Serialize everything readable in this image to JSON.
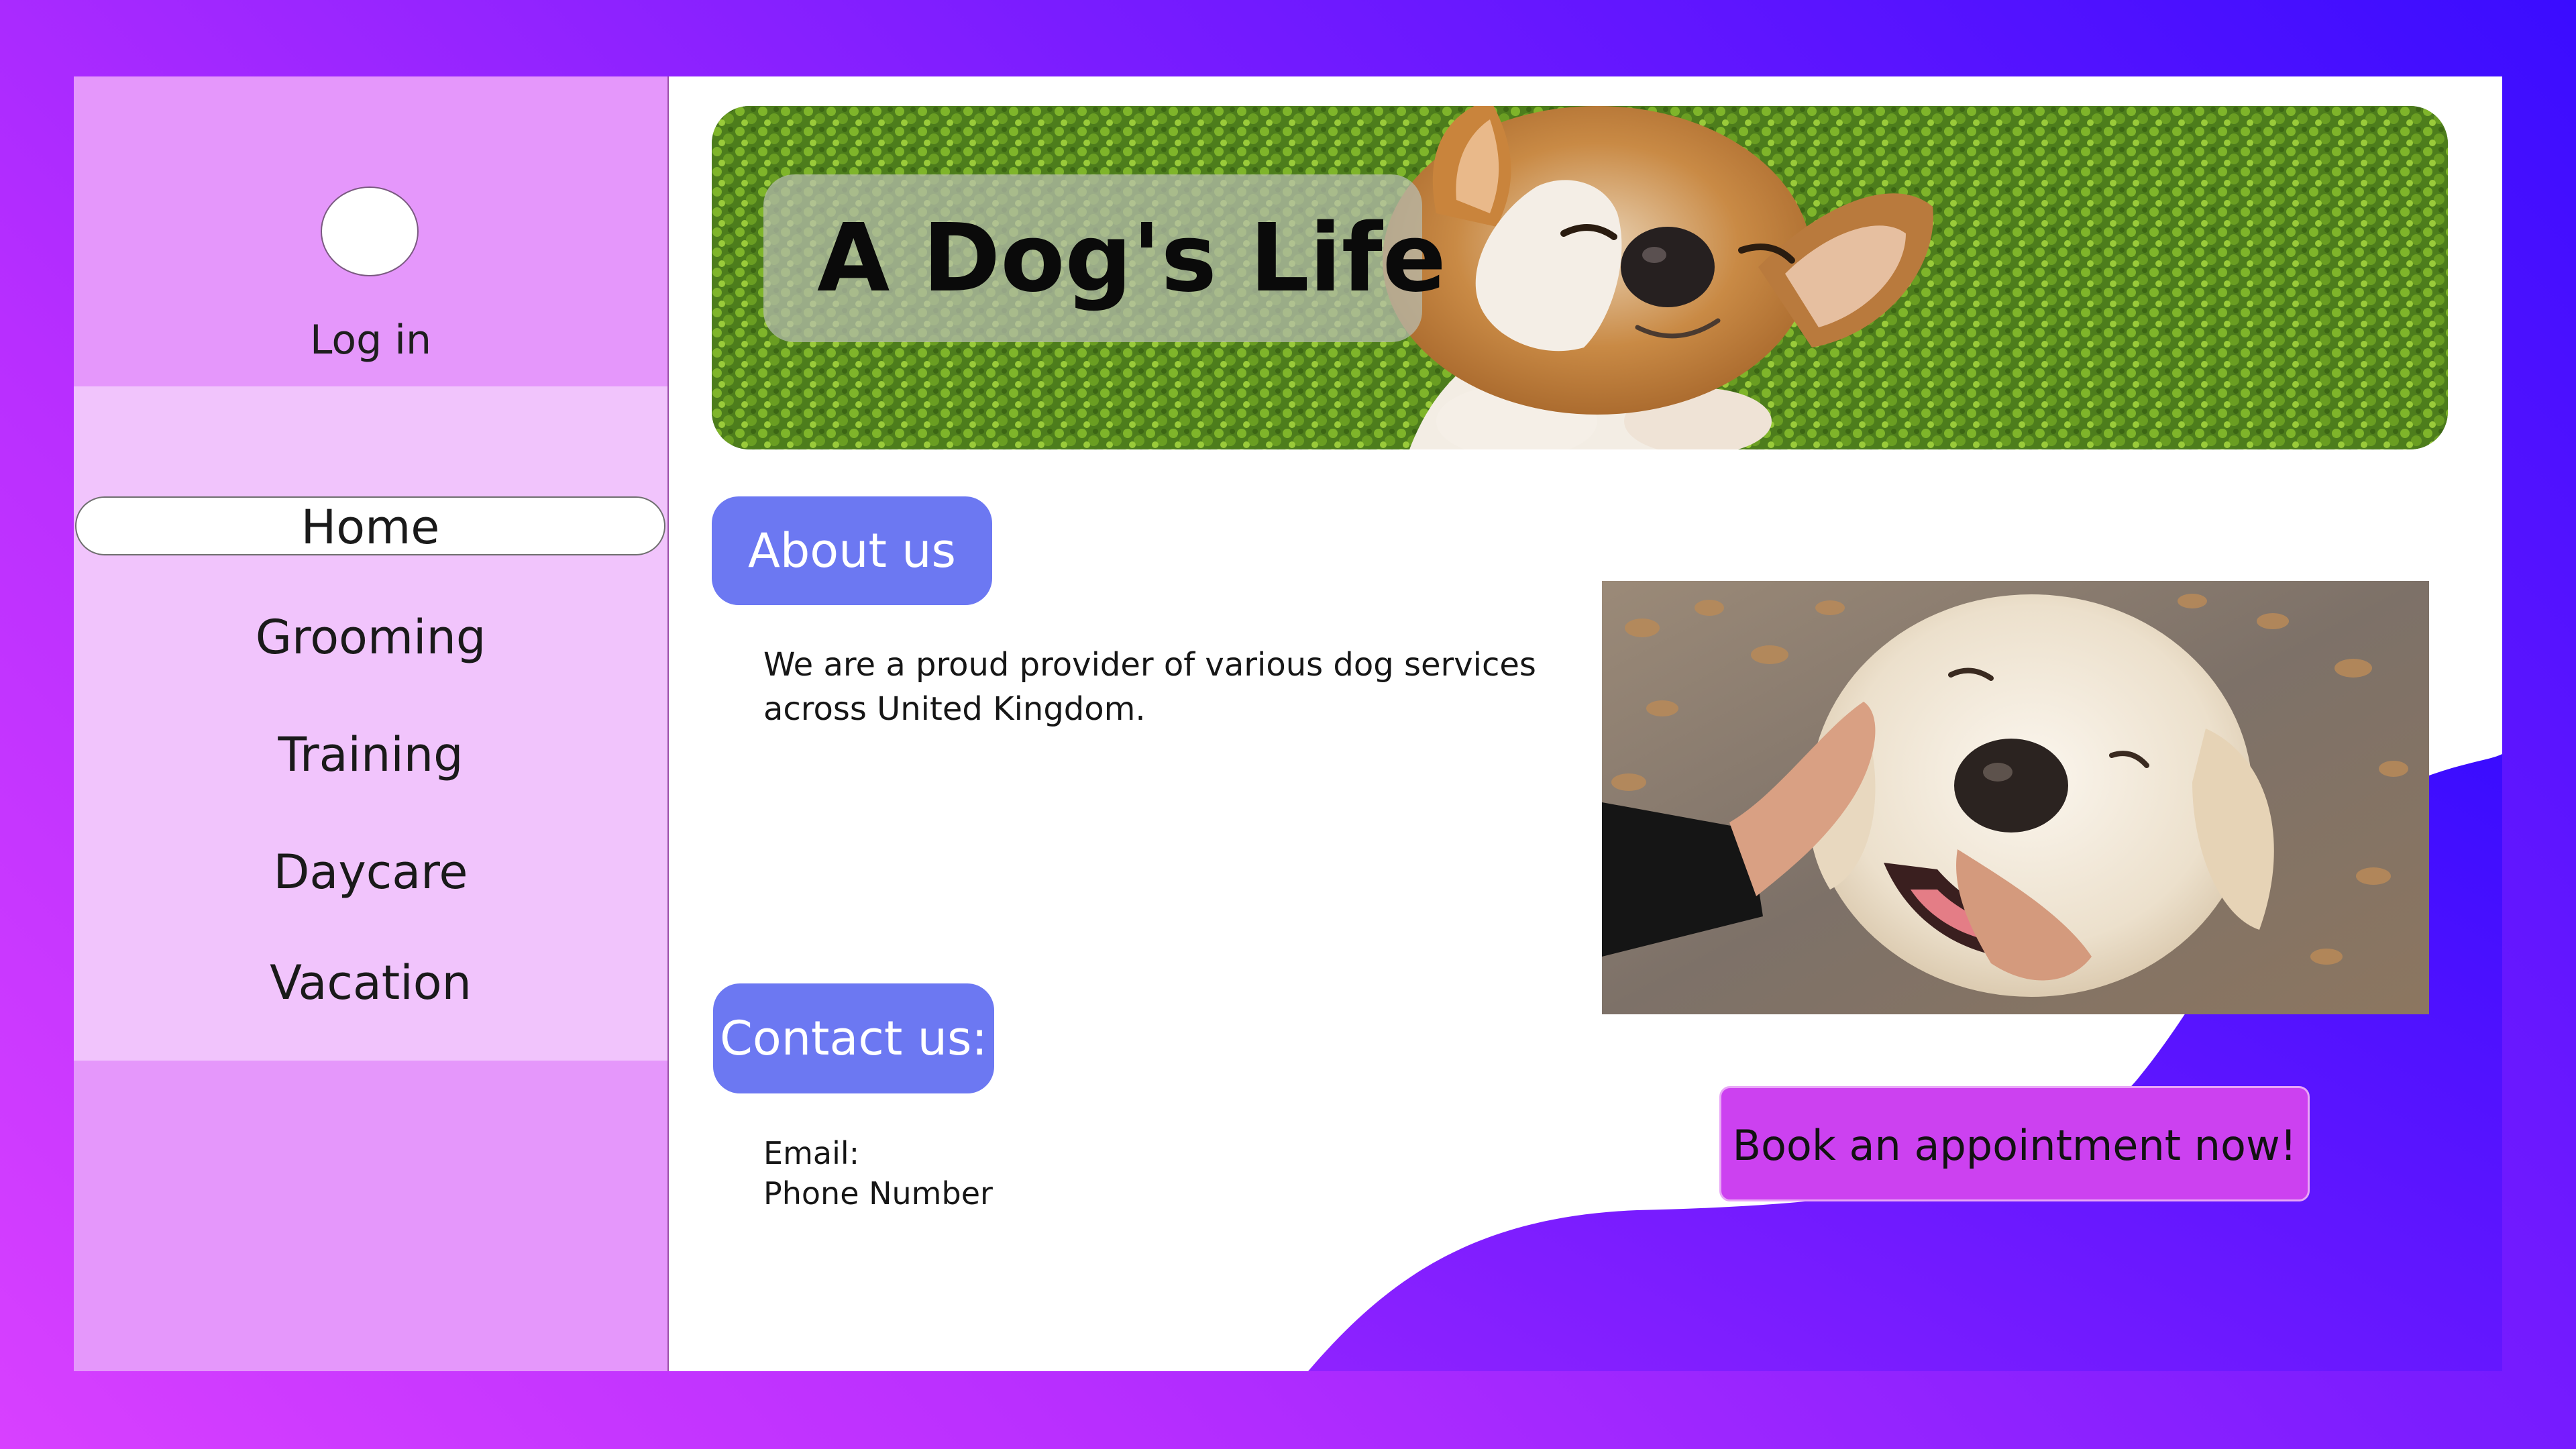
{
  "sidebar": {
    "login_label": "Log in",
    "nav_items": [
      {
        "label": "Home",
        "active": true
      },
      {
        "label": "Grooming",
        "active": false
      },
      {
        "label": "Training",
        "active": false
      },
      {
        "label": "Daycare",
        "active": false
      },
      {
        "label": "Vacation",
        "active": false
      }
    ]
  },
  "header": {
    "title": "A Dog's Life"
  },
  "about": {
    "heading": "About us",
    "text": "We are a proud provider of various dog services across United Kingdom."
  },
  "contact": {
    "heading": "Contact us:",
    "email_label": "Email:",
    "phone_label": "Phone Number"
  },
  "cta": {
    "label": "Book an appointment now!"
  },
  "icons": {
    "avatar": "user-avatar-icon"
  },
  "colors": {
    "background_gradient_start": "#d840ff",
    "background_gradient_end": "#3a0cff",
    "sidebar": "#e597fb",
    "nav_panel": "#f1c4fc",
    "pill": "#6c78f2",
    "cta": "#cc41f0"
  }
}
